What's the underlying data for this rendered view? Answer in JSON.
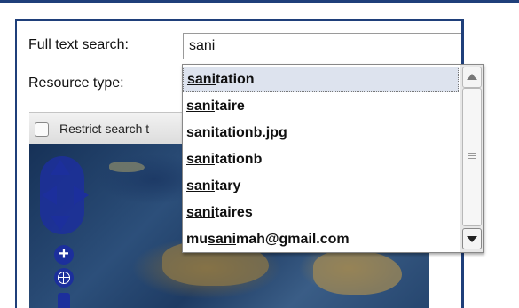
{
  "form": {
    "full_text_label": "Full text search:",
    "resource_type_label": "Resource type:",
    "search_value": "sani",
    "restrict_label": "Restrict search t"
  },
  "autocomplete": {
    "query": "sani",
    "items": [
      {
        "before": "",
        "match": "sani",
        "after": "tation",
        "selected": true
      },
      {
        "before": "",
        "match": "sani",
        "after": "taire",
        "selected": false
      },
      {
        "before": "",
        "match": "sani",
        "after": "tationb.jpg",
        "selected": false
      },
      {
        "before": "",
        "match": "sani",
        "after": "tationb",
        "selected": false
      },
      {
        "before": "",
        "match": "sani",
        "after": "tary",
        "selected": false
      },
      {
        "before": "",
        "match": "sani",
        "after": "taires",
        "selected": false
      },
      {
        "before": "mu",
        "match": "sani",
        "after": "mah@gmail.com",
        "selected": false
      }
    ]
  },
  "map_controls": {
    "zoom_in_glyph": "+",
    "world_icon": "globe-icon",
    "pan_icons": [
      "pan-up-icon",
      "pan-left-icon",
      "pan-right-icon",
      "pan-down-icon"
    ]
  },
  "colors": {
    "frame_blue": "#1f3f7a",
    "nav_blue": "#1c2f9c",
    "selected_bg": "#dde3ee"
  }
}
